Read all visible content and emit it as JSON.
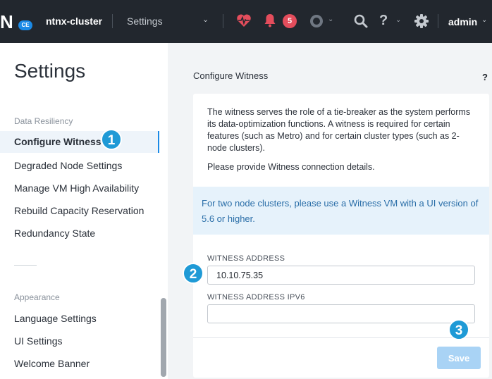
{
  "topbar": {
    "logo_text": "N",
    "logo_badge": "CE",
    "cluster_name": "ntnx-cluster",
    "menu_label": "Settings",
    "alert_count": "5",
    "user": "admin",
    "help_glyph": "?",
    "icons": [
      "health-icon",
      "bell-icon",
      "task-icon",
      "search-icon",
      "help-icon",
      "gear-icon"
    ]
  },
  "sidebar": {
    "title": "Settings",
    "sections": [
      {
        "label": "Data Resiliency",
        "items": [
          {
            "label": "Configure Witness",
            "active": true
          },
          {
            "label": "Degraded Node Settings"
          },
          {
            "label": "Manage VM High Availability"
          },
          {
            "label": "Rebuild Capacity Reservation"
          },
          {
            "label": "Redundancy State"
          }
        ]
      },
      {
        "label": "Appearance",
        "items": [
          {
            "label": "Language Settings"
          },
          {
            "label": "UI Settings"
          },
          {
            "label": "Welcome Banner"
          }
        ]
      }
    ]
  },
  "main": {
    "title": "Configure Witness",
    "help": "?",
    "description": "The witness serves the role of a tie-breaker as the system performs its data-optimization functions. A witness is required for certain features (such as Metro) and for certain cluster types (such as 2-node clusters).",
    "instruction": "Please provide Witness connection details.",
    "info": "For two node clusters, please use a Witness VM with a UI version of 5.6 or higher.",
    "fields": [
      {
        "label": "WITNESS ADDRESS",
        "value": "10.10.75.35"
      },
      {
        "label": "WITNESS ADDRESS IPV6",
        "value": ""
      }
    ],
    "save_label": "Save"
  },
  "steps": [
    "1",
    "2",
    "3"
  ],
  "colors": {
    "topbar_bg": "#22272e",
    "accent": "#1b8ae6",
    "alert": "#e44d5c",
    "step_marker": "#1f9ad6",
    "save_disabled": "#a9d3f5"
  }
}
